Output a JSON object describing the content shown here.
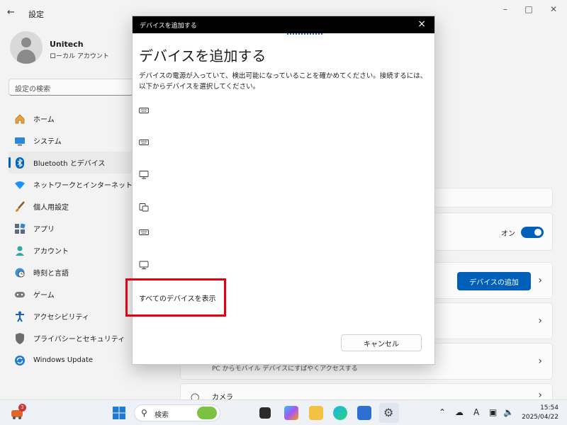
{
  "settings": {
    "title": "設定",
    "profile": {
      "name": "Unitech",
      "account_type": "ローカル アカウント"
    },
    "search_placeholder": "設定の検索",
    "nav": [
      {
        "label": "ホーム",
        "icon": "home-icon"
      },
      {
        "label": "システム",
        "icon": "system-icon"
      },
      {
        "label": "Bluetooth とデバイス",
        "icon": "bluetooth-icon",
        "active": true
      },
      {
        "label": "ネットワークとインターネット",
        "icon": "wifi-icon"
      },
      {
        "label": "個人用設定",
        "icon": "brush-icon"
      },
      {
        "label": "アプリ",
        "icon": "apps-icon"
      },
      {
        "label": "アカウント",
        "icon": "account-icon"
      },
      {
        "label": "時刻と言語",
        "icon": "globe-icon"
      },
      {
        "label": "ゲーム",
        "icon": "gamepad-icon"
      },
      {
        "label": "アクセシビリティ",
        "icon": "accessibility-icon"
      },
      {
        "label": "プライバシーとセキュリティ",
        "icon": "shield-icon"
      },
      {
        "label": "Windows Update",
        "icon": "update-icon"
      }
    ],
    "bluetooth_toggle_label": "オン",
    "add_device_button": "デバイスの追加",
    "phone_link_text": "PC からモバイル デバイスにすばやくアクセスする",
    "camera_label": "カメラ"
  },
  "dialog": {
    "title": "デバイスを追加する",
    "heading": "デバイスを追加する",
    "description": "デバイスの電源が入っていて、検出可能になっていることを確かめてください。接続するには、以下からデバイスを選択してください。",
    "devices": [
      {
        "icon": "keyboard-icon"
      },
      {
        "icon": "keyboard-icon"
      },
      {
        "icon": "monitor-icon"
      },
      {
        "icon": "devices-icon"
      },
      {
        "icon": "keyboard-icon"
      },
      {
        "icon": "monitor-icon"
      }
    ],
    "show_all_label": "すべてのデバイスを表示",
    "cancel_label": "キャンセル"
  },
  "taskbar": {
    "search_label": "検索",
    "notification_badge": "3",
    "time": "15:54",
    "date": "2025/04/22"
  },
  "colors": {
    "accent": "#005fb8",
    "highlight_box": "#e8000f"
  }
}
